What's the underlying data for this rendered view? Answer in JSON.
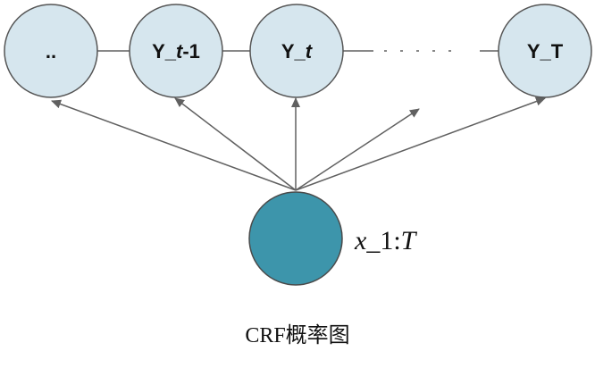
{
  "colors": {
    "state_fill": "#d6e6ee",
    "state_stroke": "#555555",
    "observation_fill": "#3d95ab",
    "edge": "#606060",
    "text": "#111111"
  },
  "nodes": {
    "state_dots": {
      "label": ".."
    },
    "state_t_minus_1": {
      "label_prefix": "Y_",
      "label_var": "t",
      "label_suffix": "-1"
    },
    "state_t": {
      "label_prefix": "Y_",
      "label_var": "t"
    },
    "state_T": {
      "label": "Y_T"
    }
  },
  "observation": {
    "label_prefix": "x",
    "label_middle": "_1:",
    "label_var": "T"
  },
  "caption": "CRF概率图"
}
